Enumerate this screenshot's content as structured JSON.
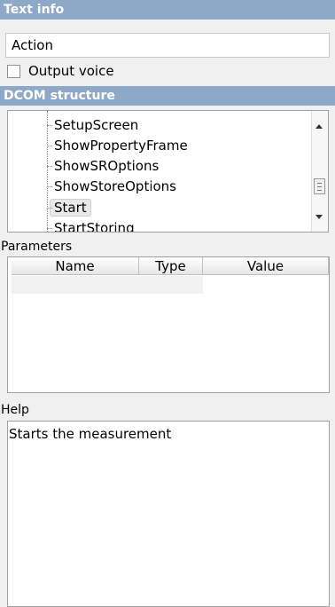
{
  "text_info": {
    "header": "Text info",
    "action_value": "Action",
    "output_voice_label": "Output voice",
    "output_voice_checked": false
  },
  "dcom": {
    "header": "DCOM structure",
    "items": [
      "SetupScreen",
      "ShowPropertyFrame",
      "ShowSROptions",
      "ShowStoreOptions",
      "Start",
      "StartStoring"
    ],
    "selected": "Start"
  },
  "parameters": {
    "label": "Parameters",
    "columns": [
      "Name",
      "Type",
      "Value"
    ]
  },
  "help": {
    "label": "Help",
    "text": "Starts the measurement"
  }
}
